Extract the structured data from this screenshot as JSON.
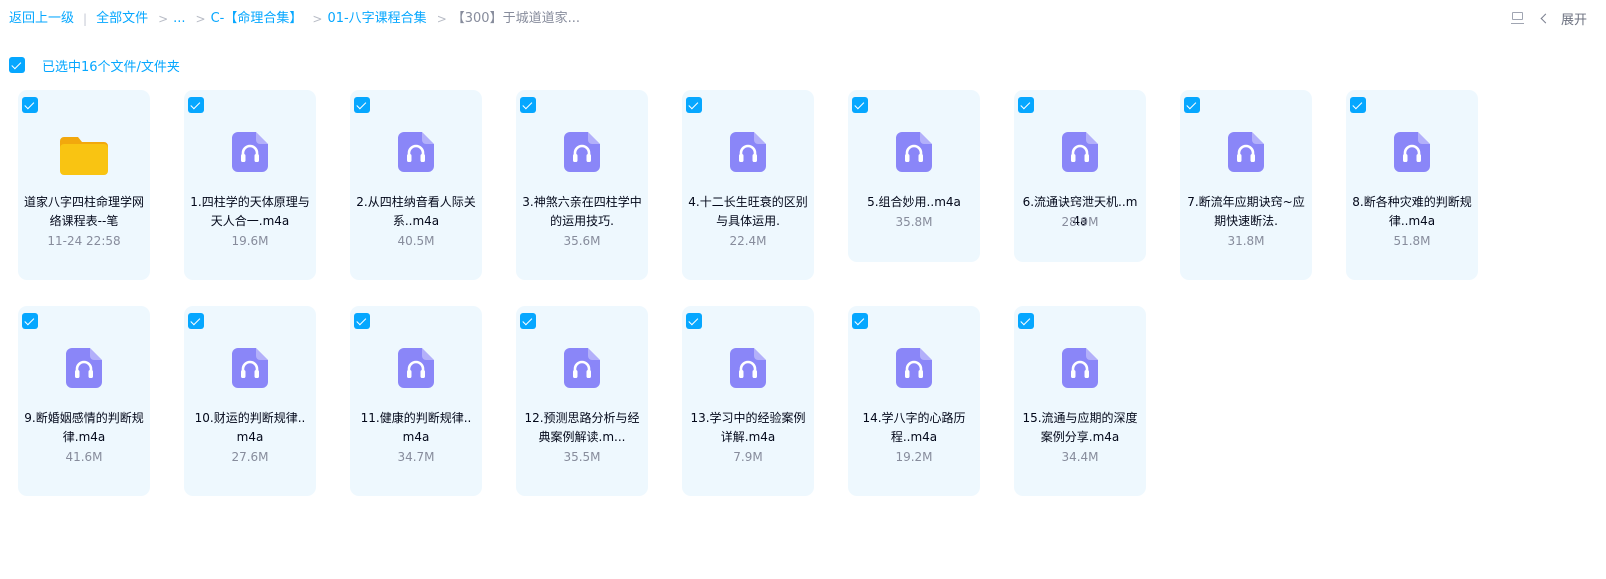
{
  "breadcrumb": {
    "back": "返回上一级",
    "divider": "|",
    "root": "全部文件",
    "sep": ">",
    "ellipsis": "...",
    "level1": "C-【命理合集】",
    "level2": "01-八字课程合集",
    "current": "【300】于城道道家..."
  },
  "toolbar": {
    "layout_icon": "layout-toggle-icon",
    "expand_label": "展开"
  },
  "selection": {
    "text": "已选中16个文件/文件夹",
    "all_checked": true
  },
  "colors": {
    "accent": "#06a7ff",
    "card_bg": "#eef8fe",
    "audio_icon": "#8a86f8",
    "folder": "#f9c412"
  },
  "files": [
    {
      "type": "folder",
      "icon": "folder-icon",
      "name": "道家八字四柱命理学网络课程表--笔",
      "meta": "11-24 22:58",
      "checked": true
    },
    {
      "type": "audio",
      "icon": "audio-file-icon",
      "name": "1.四柱学的天体原理与天人合一.m4a",
      "meta": "19.6M",
      "checked": true
    },
    {
      "type": "audio",
      "icon": "audio-file-icon",
      "name": "2.从四柱纳音看人际关系..m4a",
      "meta": "40.5M",
      "checked": true
    },
    {
      "type": "audio",
      "icon": "audio-file-icon",
      "name": "3.神煞六亲在四柱学中的运用技巧.",
      "meta": "35.6M",
      "checked": true
    },
    {
      "type": "audio",
      "icon": "audio-file-icon",
      "name": "4.十二长生旺衰的区别与具体运用.",
      "meta": "22.4M",
      "checked": true
    },
    {
      "type": "audio",
      "icon": "audio-file-icon",
      "name": "5.组合妙用..m4a",
      "meta": "35.8M",
      "checked": true
    },
    {
      "type": "audio",
      "icon": "audio-file-icon",
      "name": "6.流通诀窍泄天机..m4a",
      "meta": "28.9M",
      "checked": true
    },
    {
      "type": "audio",
      "icon": "audio-file-icon",
      "name": "7.断流年应期诀窍~应期快速断法.",
      "meta": "31.8M",
      "checked": true
    },
    {
      "type": "audio",
      "icon": "audio-file-icon",
      "name": "8.断各种灾难的判断规律..m4a",
      "meta": "51.8M",
      "checked": true
    },
    {
      "type": "audio",
      "icon": "audio-file-icon",
      "name": "9.断婚姻感情的判断规律.m4a",
      "meta": "41.6M",
      "checked": true
    },
    {
      "type": "audio",
      "icon": "audio-file-icon",
      "name": "10.财运的判断规律..m4a",
      "meta": "27.6M",
      "checked": true
    },
    {
      "type": "audio",
      "icon": "audio-file-icon",
      "name": "11.健康的判断规律..m4a",
      "meta": "34.7M",
      "checked": true
    },
    {
      "type": "audio",
      "icon": "audio-file-icon",
      "name": "12.预测思路分析与经典案例解读.m...",
      "meta": "35.5M",
      "checked": true
    },
    {
      "type": "audio",
      "icon": "audio-file-icon",
      "name": "13.学习中的经验案例详解.m4a",
      "meta": "7.9M",
      "checked": true
    },
    {
      "type": "audio",
      "icon": "audio-file-icon",
      "name": "14.学八字的心路历程..m4a",
      "meta": "19.2M",
      "checked": true
    },
    {
      "type": "audio",
      "icon": "audio-file-icon",
      "name": "15.流通与应期的深度案例分享.m4a",
      "meta": "34.4M",
      "checked": true
    }
  ]
}
